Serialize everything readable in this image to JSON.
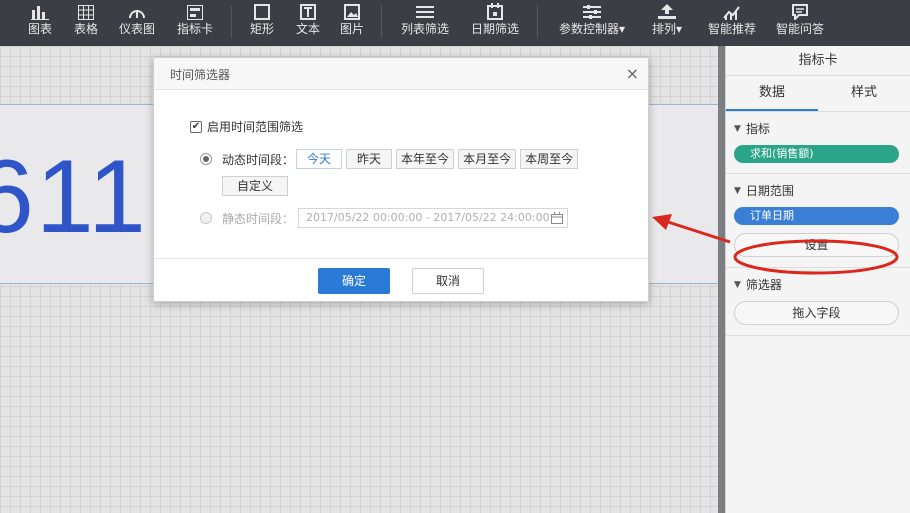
{
  "toolbar": {
    "items": [
      {
        "label": "图表",
        "icon": "bar-chart-icon"
      },
      {
        "label": "表格",
        "icon": "table-icon"
      },
      {
        "label": "仪表图",
        "icon": "gauge-icon"
      },
      {
        "label": "指标卡",
        "icon": "indicator-card-icon"
      },
      {
        "label": "矩形",
        "icon": "rectangle-icon"
      },
      {
        "label": "文本",
        "icon": "text-icon"
      },
      {
        "label": "图片",
        "icon": "image-icon"
      },
      {
        "label": "列表筛选",
        "icon": "list-filter-icon"
      },
      {
        "label": "日期筛选",
        "icon": "date-filter-icon"
      },
      {
        "label": "参数控制器▾",
        "icon": "param-controller-icon"
      },
      {
        "label": "排列▾",
        "icon": "arrange-icon"
      },
      {
        "label": "智能推荐",
        "icon": "smart-recommend-icon"
      },
      {
        "label": "智能问答",
        "icon": "smart-qa-icon"
      }
    ]
  },
  "canvas": {
    "card_value": "611"
  },
  "panel": {
    "title": "指标卡",
    "tabs": [
      "数据",
      "样式"
    ],
    "active_tab": "数据",
    "sections": {
      "metric": {
        "title": "指标",
        "pill": "求和(销售额)"
      },
      "date_range": {
        "title": "日期范围",
        "pill": "订单日期",
        "button": "设置"
      },
      "filter": {
        "title": "筛选器",
        "button": "拖入字段"
      }
    }
  },
  "dialog": {
    "title": "时间筛选器",
    "close": "×",
    "enable_label": "启用时间范围筛选",
    "dynamic_label": "动态时间段：",
    "dynamic_options": [
      "今天",
      "昨天",
      "本年至今",
      "本月至今",
      "本周至今"
    ],
    "selected_option": "今天",
    "custom_label": "自定义",
    "static_label": "静态时间段：",
    "static_range": "2017/05/22 00:00:00 - 2017/05/22 24:00:00",
    "confirm": "确定",
    "cancel": "取消"
  },
  "colors": {
    "toolbar_bg": "#3b3f45",
    "accent": "#2b7bd6",
    "pill_green": "#2aa58a",
    "pill_blue": "#3a7fd5",
    "annotation_red": "#d9281e",
    "card_value": "#2f55c8"
  }
}
